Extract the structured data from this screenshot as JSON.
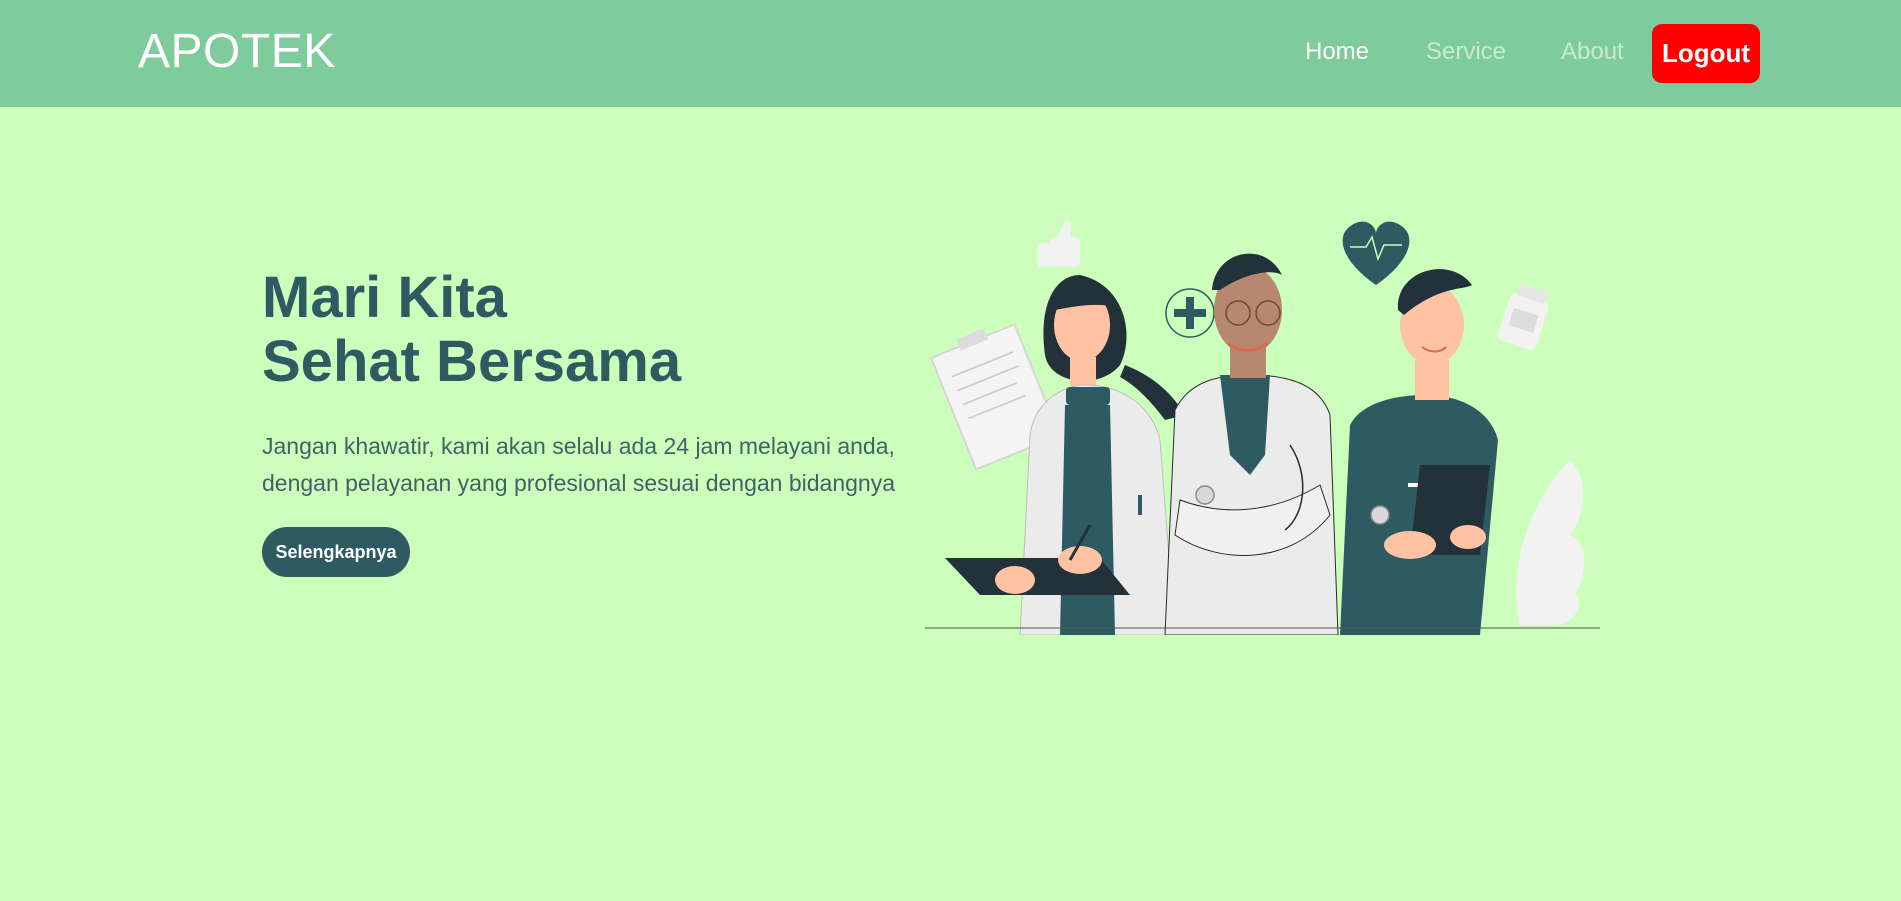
{
  "navbar": {
    "brand": "APOTEK",
    "links": [
      {
        "label": "Home",
        "active": true
      },
      {
        "label": "Service",
        "active": false
      },
      {
        "label": "About",
        "active": false
      }
    ],
    "logout_label": "Logout"
  },
  "hero": {
    "title_line1": "Mari Kita",
    "title_line2": "Sehat Bersama",
    "desc_line1": "Jangan khawatir, kami akan selalu ada 24 jam melayani anda,",
    "desc_line2": "dengan pelayanan yang profesional sesuai dengan bidangnya",
    "cta_label": "Selengkapnya"
  },
  "colors": {
    "background": "#ccffbb",
    "navbar": "#7ecb9c",
    "primary": "#2e5b62",
    "logout": "#ff0000"
  },
  "icons": [
    "thumbs-up-icon",
    "plus-circle-icon",
    "heart-pulse-icon",
    "medicine-bottle-icon",
    "clipboard-icon"
  ]
}
